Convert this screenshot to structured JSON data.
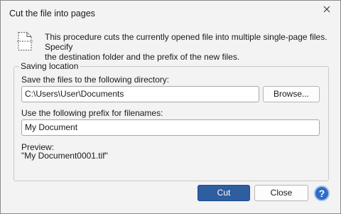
{
  "window": {
    "title": "Cut the file into pages"
  },
  "intro": {
    "icon": "page-cut-icon",
    "line1": "This procedure cuts the currently opened file into multiple single-page files. Specify",
    "line2": "the destination folder and the prefix of the new files."
  },
  "group": {
    "title": "Saving location"
  },
  "directory": {
    "label": "Save the files to the following directory:",
    "value": "C:\\Users\\User\\Documents",
    "browse_label": "Browse..."
  },
  "prefix": {
    "label": "Use the following prefix for filenames:",
    "value": "My Document"
  },
  "preview": {
    "label": "Preview:",
    "value": "\"My Document0001.tif\""
  },
  "footer": {
    "cut_label": "Cut",
    "close_label": "Close",
    "help_label": "?"
  },
  "colors": {
    "accent": "#2e5da0",
    "help": "#2f6cc2"
  }
}
